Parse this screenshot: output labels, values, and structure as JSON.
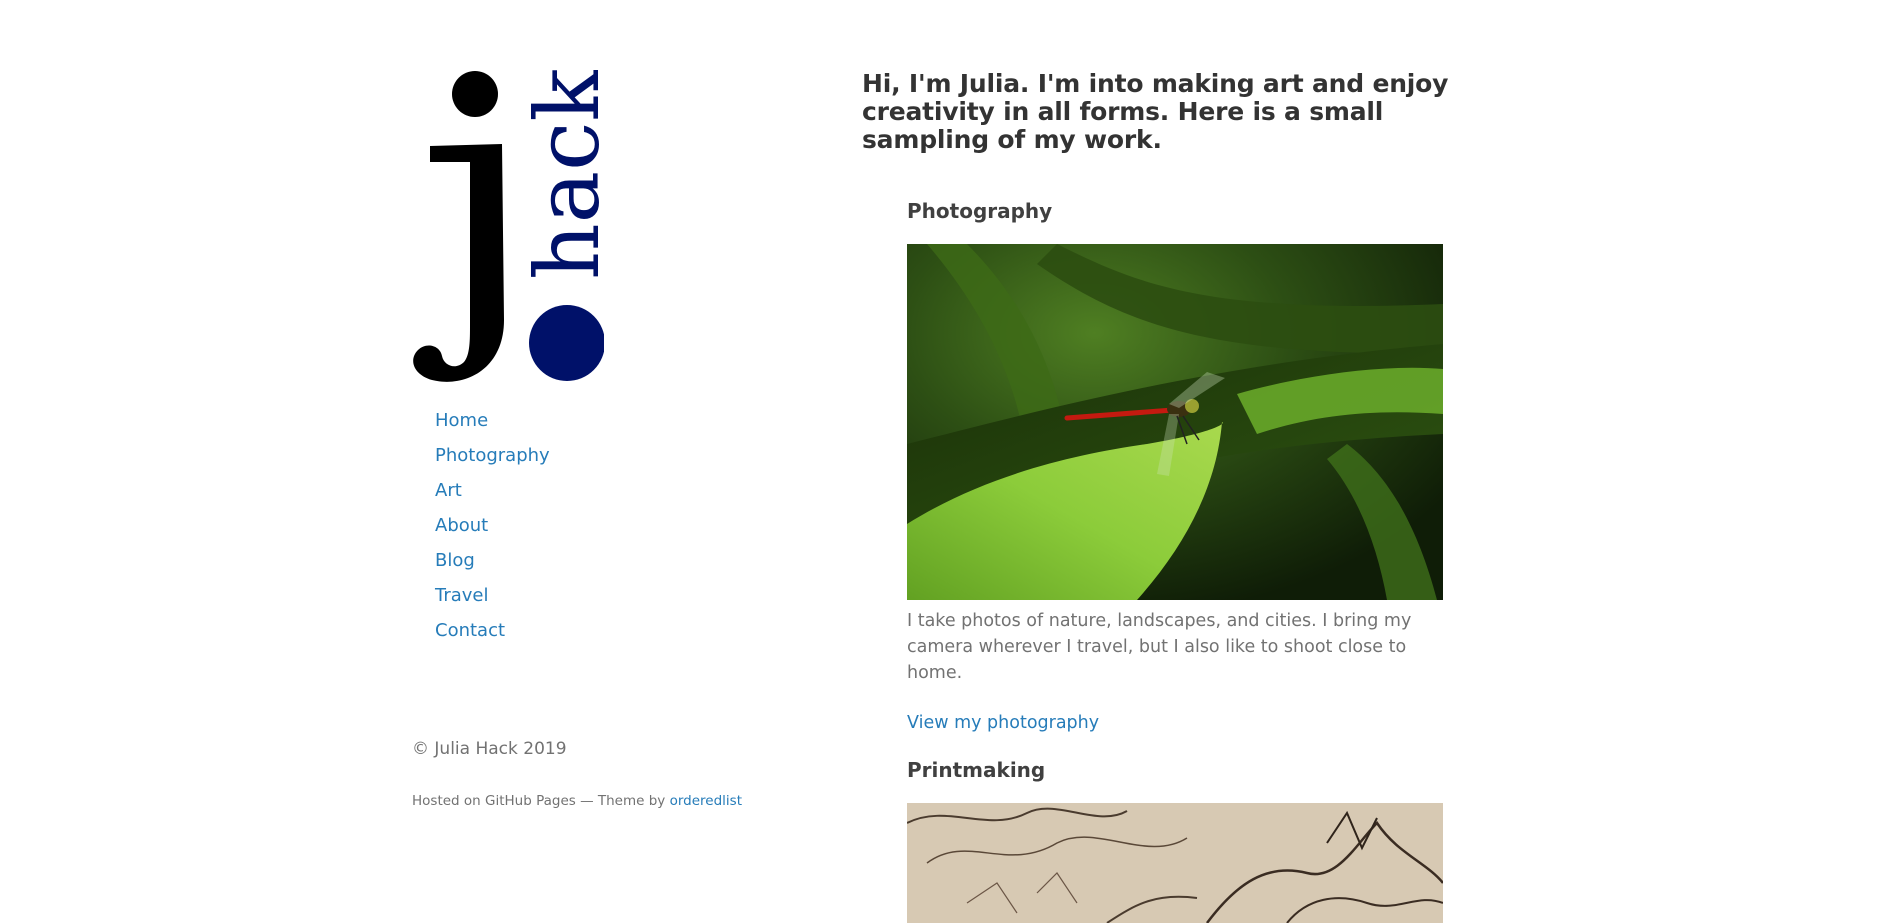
{
  "site": {
    "logo_text": {
      "initial": "j",
      "name": "hack"
    },
    "colors": {
      "accent": "#267CB9",
      "logo_blue": "#001169",
      "logo_black": "#000000",
      "heading": "#333333",
      "text": "#727272"
    }
  },
  "nav": {
    "items": [
      {
        "label": "Home"
      },
      {
        "label": "Photography"
      },
      {
        "label": "Art"
      },
      {
        "label": "About"
      },
      {
        "label": "Blog"
      },
      {
        "label": "Travel"
      },
      {
        "label": "Contact"
      }
    ]
  },
  "footer": {
    "copyright": "© Julia Hack 2019",
    "hosted_prefix": "Hosted on GitHub Pages — Theme by ",
    "theme_link": "orderedlist"
  },
  "main": {
    "intro": "Hi, I'm Julia. I'm into making art and enjoy creativity in all forms. Here is a small sampling of my work.",
    "sections": [
      {
        "title": "Photography",
        "image_alt_icon": "dragonfly-on-leaf-photo",
        "description": "I take photos of nature, landscapes, and cities. I bring my camera wherever I travel, but I also like to shoot close to home.",
        "link": "View my photography"
      },
      {
        "title": "Printmaking",
        "image_alt_icon": "etching-print-photo"
      }
    ]
  }
}
